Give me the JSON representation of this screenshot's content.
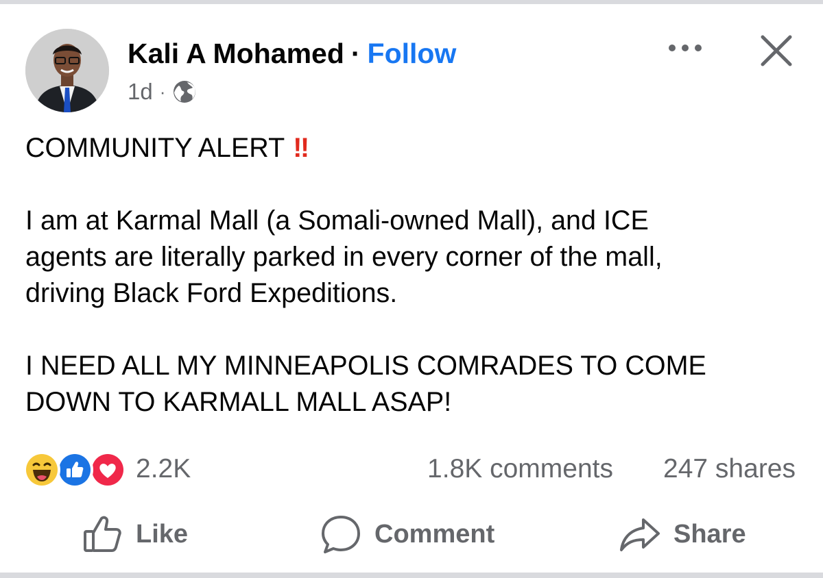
{
  "post": {
    "author": "Kali A Mohamed",
    "separator": "·",
    "follow_label": "Follow",
    "time": "1d",
    "time_separator": "·",
    "audience_icon": "globe-icon",
    "body": {
      "alert_text": "COMMUNITY ALERT",
      "alert_mark": "‼",
      "paragraph1": [
        "I am at Karmal Mall (a Somali-owned Mall), and ICE",
        "agents are literally parked in every corner of the mall,",
        "driving Black Ford Expeditions."
      ],
      "paragraph2": [
        "I NEED ALL MY MINNEAPOLIS COMRADES TO COME",
        "DOWN TO KARMALL MALL ASAP!"
      ]
    }
  },
  "engagement": {
    "reaction_icons": [
      "haha-icon",
      "like-reaction-icon",
      "love-icon"
    ],
    "reactions_count": "2.2K",
    "comments_count": "1.8K comments",
    "shares_count": "247 shares"
  },
  "actions": {
    "like_label": "Like",
    "comment_label": "Comment",
    "share_label": "Share"
  },
  "colors": {
    "accent": "#1877f2",
    "alert": "#e12a1e",
    "secondary_text": "#65676b",
    "divider": "#d9dade"
  }
}
